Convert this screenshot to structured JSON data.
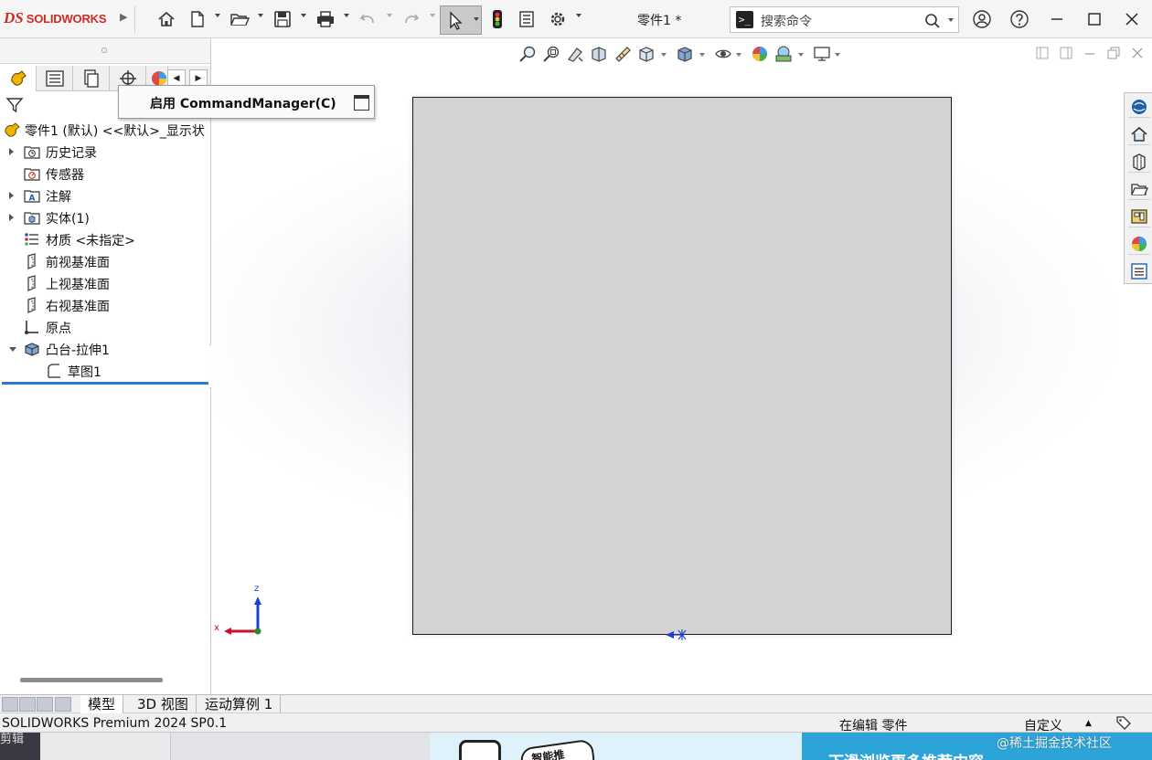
{
  "app": {
    "brand": "SOLIDWORKS",
    "brand_mark": "DS",
    "document_title": "零件1 *",
    "search_placeholder": "搜索命令"
  },
  "toolbar": {
    "icons": [
      "home-icon",
      "new-document-icon",
      "open-folder-icon",
      "save-icon",
      "print-icon",
      "undo-icon",
      "redo-icon",
      "select-arrow-icon",
      "rebuild-traffic-light-icon",
      "file-properties-icon",
      "options-gear-icon"
    ],
    "window_controls": [
      "account-icon",
      "help-icon",
      "minimize-icon",
      "maximize-icon",
      "close-icon"
    ]
  },
  "tooltip": {
    "label": "启用 CommandManager(C)"
  },
  "feature_tree": {
    "root_label": "零件1 (默认) <<默认>_显示状",
    "items": [
      {
        "label": "历史记录",
        "icon": "history-folder-icon",
        "expandable": true,
        "expanded": false,
        "indent": 0
      },
      {
        "label": "传感器",
        "icon": "sensor-icon",
        "expandable": false,
        "expanded": false,
        "indent": 0
      },
      {
        "label": "注解",
        "icon": "annotations-icon",
        "expandable": true,
        "expanded": false,
        "indent": 0
      },
      {
        "label": "实体(1)",
        "icon": "solid-bodies-icon",
        "expandable": true,
        "expanded": false,
        "indent": 0
      },
      {
        "label": "材质 <未指定>",
        "icon": "material-icon",
        "expandable": false,
        "expanded": false,
        "indent": 0
      },
      {
        "label": "前视基准面",
        "icon": "plane-icon",
        "expandable": false,
        "expanded": false,
        "indent": 0
      },
      {
        "label": "上视基准面",
        "icon": "plane-icon",
        "expandable": false,
        "expanded": false,
        "indent": 0
      },
      {
        "label": "右视基准面",
        "icon": "plane-icon",
        "expandable": false,
        "expanded": false,
        "indent": 0
      },
      {
        "label": "原点",
        "icon": "origin-icon",
        "expandable": false,
        "expanded": false,
        "indent": 0
      },
      {
        "label": "凸台-拉伸1",
        "icon": "boss-extrude-icon",
        "expandable": true,
        "expanded": true,
        "indent": 0
      },
      {
        "label": "草图1",
        "icon": "sketch-icon",
        "expandable": false,
        "expanded": false,
        "indent": 1
      }
    ]
  },
  "triad": {
    "x_label": "x",
    "z_label": "z"
  },
  "bottom_tabs": [
    "模型",
    "3D 视图",
    "运动算例 1"
  ],
  "active_bottom_tab": 0,
  "status": {
    "version": "SOLIDWORKS Premium 2024 SP0.1",
    "editing": "在编辑 零件",
    "units": "自定义"
  },
  "overlay": {
    "left_text": "剪辑",
    "bubble_text": "智能推",
    "banner_text": "下滑浏览更多推荐内容",
    "watermark": "@稀土掘金技术社区"
  },
  "colors": {
    "brand_red": "#d02b20",
    "part_fill": "#d3d3d3",
    "tree_selection_line": "#2e78c8",
    "axis_x": "#c8102e",
    "axis_z": "#1f3fd1"
  }
}
